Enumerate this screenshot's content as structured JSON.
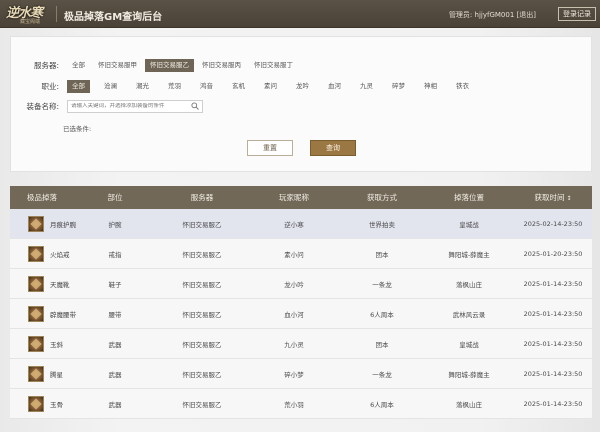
{
  "header": {
    "logo_main": "逆水寒",
    "logo_sub": "藏宝阁端",
    "title": "极品掉落GM查询后台",
    "admin_label": "管理员:",
    "admin_name": "hjjyfGM001",
    "admin_exit": "[退出]",
    "logout_button": "登录记录"
  },
  "filters": {
    "server": {
      "label": "服务器:",
      "options": [
        "全部",
        "怀旧交易服甲",
        "怀旧交易服乙",
        "怀旧交易服丙",
        "怀旧交易服丁"
      ],
      "selected_index": 2
    },
    "job": {
      "label": "职业:",
      "options": [
        "全部",
        "沧澜",
        "潮光",
        "荒羽",
        "鸿音",
        "玄机",
        "素问",
        "龙吟",
        "血河",
        "九灵",
        "碎梦",
        "神相",
        "铁衣"
      ],
      "selected_index": 0
    },
    "equipment": {
      "label": "装备名称:",
      "placeholder": "请输入关键词，并选择添加装备的条件"
    },
    "selected_conditions_label": "已选条件:",
    "reset_button": "重置",
    "query_button": "查询"
  },
  "table": {
    "columns": [
      "极品掉落",
      "部位",
      "服务器",
      "玩家昵称",
      "获取方式",
      "掉落位置",
      "获取时间"
    ],
    "sort_marker": "↕",
    "rows": [
      {
        "item": "月痕护腕",
        "slot": "护腕",
        "server": "怀旧交易服乙",
        "player": "逆小寒",
        "method": "世界拍卖",
        "location": "皇城战",
        "time": "2025-02-14-23:50",
        "highlight": true
      },
      {
        "item": "火焰戒",
        "slot": "戒指",
        "server": "怀旧交易服乙",
        "player": "素小问",
        "method": "团本",
        "location": "舞阳城-薛魔主",
        "time": "2025-01-20-23:50",
        "highlight": false
      },
      {
        "item": "天魔靴",
        "slot": "鞋子",
        "server": "怀旧交易服乙",
        "player": "龙小吟",
        "method": "一条龙",
        "location": "落枫山庄",
        "time": "2025-01-14-23:50",
        "highlight": false
      },
      {
        "item": "辟魔腰带",
        "slot": "腰带",
        "server": "怀旧交易服乙",
        "player": "血小河",
        "method": "6人周本",
        "location": "武林风云录",
        "time": "2025-01-14-23:50",
        "highlight": false
      },
      {
        "item": "玉斜",
        "slot": "武器",
        "server": "怀旧交易服乙",
        "player": "九小灵",
        "method": "团本",
        "location": "皇城战",
        "time": "2025-01-14-23:50",
        "highlight": false
      },
      {
        "item": "腾星",
        "slot": "武器",
        "server": "怀旧交易服乙",
        "player": "碎小梦",
        "method": "一条龙",
        "location": "舞阳城-薛魔主",
        "time": "2025-01-14-23:50",
        "highlight": false
      },
      {
        "item": "玉骨",
        "slot": "武器",
        "server": "怀旧交易服乙",
        "player": "荒小羽",
        "method": "6人周本",
        "location": "落枫山庄",
        "time": "2025-01-14-23:50",
        "highlight": false
      }
    ]
  }
}
